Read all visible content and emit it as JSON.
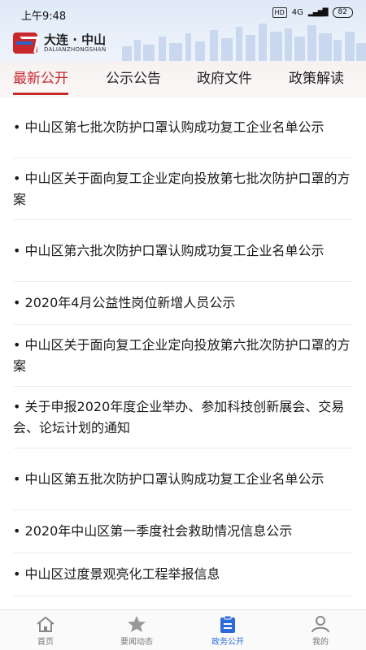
{
  "status": {
    "time": "上午9:48",
    "hd": "HD",
    "network": "4G",
    "battery": "82"
  },
  "header": {
    "title": "大连 · 中山",
    "subtitle": "DALIANZHONGSHAN"
  },
  "tabs": [
    {
      "label": "最新公开",
      "active": true
    },
    {
      "label": "公示公告",
      "active": false
    },
    {
      "label": "政府文件",
      "active": false
    },
    {
      "label": "政策解读",
      "active": false
    }
  ],
  "items": [
    "• 中山区第七批次防护口罩认购成功复工企业名单公示",
    "• 中山区关于面向复工企业定向投放第七批次防护口罩的方案",
    "• 中山区第六批次防护口罩认购成功复工企业名单公示",
    "• 2020年4月公益性岗位新增人员公示",
    "• 中山区关于面向复工企业定向投放第六批次防护口罩的方案",
    "• 关于申报2020年度企业举办、参加科技创新展会、交易会、论坛计划的通知",
    "• 中山区第五批次防护口罩认购成功复工企业名单公示",
    "• 2020年中山区第一季度社会救助情况信息公示",
    "• 中山区过度景观亮化工程举报信息"
  ],
  "nav": [
    {
      "label": "首页",
      "icon": "home-icon",
      "active": false
    },
    {
      "label": "要闻动态",
      "icon": "star-icon",
      "active": false
    },
    {
      "label": "政务公开",
      "icon": "clipboard-icon",
      "active": true
    },
    {
      "label": "我的",
      "icon": "user-icon",
      "active": false
    }
  ],
  "colors": {
    "accent": "#c8282c",
    "nav_active": "#2e6bd9",
    "text": "#1a1a1a"
  }
}
